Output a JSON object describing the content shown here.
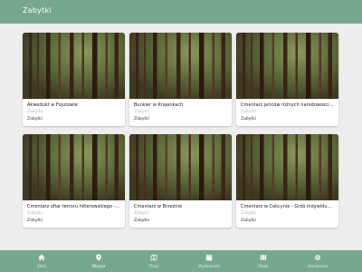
{
  "header": {
    "title": "Zabytki"
  },
  "cards": [
    {
      "name": "Akwedukt w Fojutowie",
      "subtitle": "Zabytki",
      "category": "Zabytki"
    },
    {
      "name": "Bunkier w Krajenkach",
      "subtitle": "Zabytki",
      "category": "Zabytki"
    },
    {
      "name": "Cmentarz jeńców różnych narodowości z I...",
      "subtitle": "Zabytki",
      "category": "Zabytki"
    },
    {
      "name": "Cmentarz ofiar terroru hitlerowskiego - M...",
      "subtitle": "Zabytki",
      "category": "Zabytki"
    },
    {
      "name": "Cmentarz w Brzeźnie",
      "subtitle": "Zabytki",
      "category": "Zabytki"
    },
    {
      "name": "Cmentarz w Cekcynie - Grób indywidualn...",
      "subtitle": "Zabytki",
      "category": "Zabytki"
    }
  ],
  "tabbar": {
    "items": [
      {
        "label": "Start",
        "icon": "home-icon",
        "active": false
      },
      {
        "label": "Miejsca",
        "icon": "location-pin-icon",
        "active": true
      },
      {
        "label": "Trasy",
        "icon": "route-icon",
        "active": false
      },
      {
        "label": "Wydarzenia",
        "icon": "calendar-icon",
        "active": false
      },
      {
        "label": "Mapa",
        "icon": "map-icon",
        "active": false
      },
      {
        "label": "Ustawienia",
        "icon": "gear-icon",
        "active": false
      }
    ]
  },
  "colors": {
    "brand": "#76a88e",
    "background": "#ededed"
  }
}
